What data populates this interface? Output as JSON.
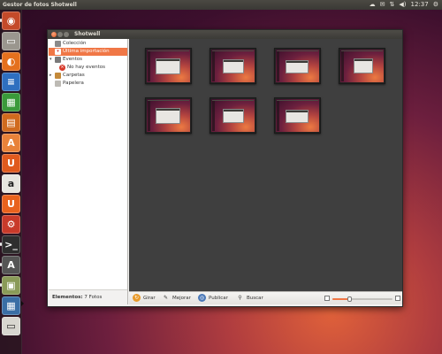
{
  "top_panel": {
    "app_title": "Gestor de fotos Shotwell",
    "clock": "12:37",
    "indicator_icons": [
      "cloud-icon",
      "mail-icon",
      "network-icon",
      "volume-icon",
      "power-gear-icon"
    ]
  },
  "launcher": {
    "items": [
      {
        "name": "dash-home-icon",
        "glyph": "◉",
        "color": "#c44a2a"
      },
      {
        "name": "files-icon",
        "glyph": "▭",
        "color": "#9a968e"
      },
      {
        "name": "firefox-icon",
        "glyph": "◐",
        "color": "#e4701e"
      },
      {
        "name": "writer-icon",
        "glyph": "≡",
        "color": "#2f6fbf"
      },
      {
        "name": "calc-icon",
        "glyph": "▦",
        "color": "#3a9a3a"
      },
      {
        "name": "impress-icon",
        "glyph": "▤",
        "color": "#d06a1e"
      },
      {
        "name": "software-center-icon",
        "glyph": "A",
        "color": "#e8823a"
      },
      {
        "name": "ubuntu-one-icon",
        "glyph": "U",
        "color": "#e05a1e"
      },
      {
        "name": "amazon-icon",
        "glyph": "a",
        "color": "#e8e6e0"
      },
      {
        "name": "ubuntu-one-music-icon",
        "glyph": "U",
        "color": "#e8621e"
      },
      {
        "name": "system-settings-icon",
        "glyph": "⚙",
        "color": "#c83a2a"
      },
      {
        "name": "terminal-icon",
        "glyph": ">_",
        "color": "#2e2e2e"
      },
      {
        "name": "update-manager-icon",
        "glyph": "A",
        "color": "#555555"
      },
      {
        "name": "shotwell-icon",
        "glyph": "▣",
        "color": "#8a9a58"
      },
      {
        "name": "workspace-switcher-icon",
        "glyph": "▦",
        "color": "#3a6ea5"
      },
      {
        "name": "trash-icon",
        "glyph": "▭",
        "color": "#d8d6d0"
      }
    ]
  },
  "window": {
    "title": "Shotwell"
  },
  "sidebar": {
    "items": [
      {
        "label": "Colección",
        "icon": "library-icon"
      },
      {
        "label": "Última importación",
        "icon": "import-icon"
      },
      {
        "label": "Eventos",
        "icon": "events-icon"
      },
      {
        "label": "No hay eventos",
        "icon": "no-events-icon"
      },
      {
        "label": "Carpetas",
        "icon": "folders-icon"
      },
      {
        "label": "Papelera",
        "icon": "trash-icon"
      }
    ],
    "status_label": "Elementos:",
    "status_value": "7 Fotos"
  },
  "photos": {
    "count": 7,
    "items": [
      "photo-1",
      "photo-2",
      "photo-3",
      "photo-4",
      "photo-5",
      "photo-6",
      "photo-7"
    ]
  },
  "toolbar": {
    "rotate_label": "Girar",
    "enhance_label": "Mejorar",
    "publish_label": "Publicar",
    "search_label": "Buscar",
    "zoom_level": 0.3
  },
  "colors": {
    "accent": "#f07746",
    "panel": "#3c3b37",
    "viewport_bg": "#3f3f3f"
  }
}
